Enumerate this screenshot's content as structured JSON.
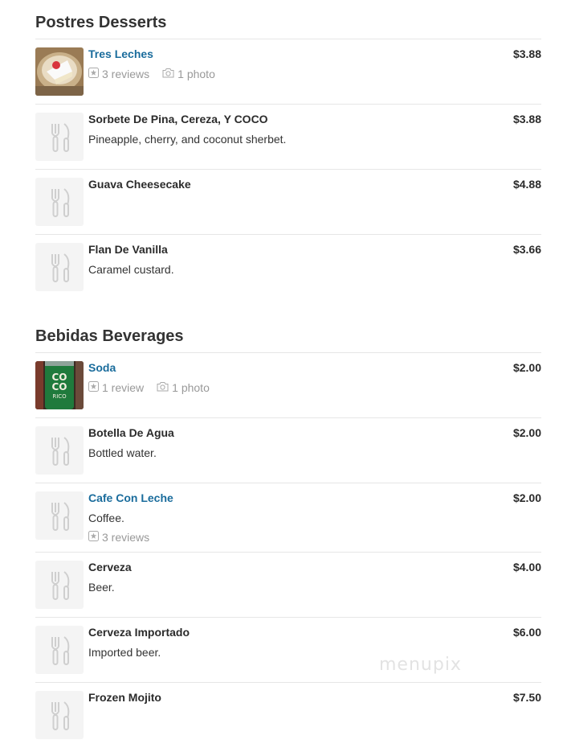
{
  "sections": [
    {
      "title": "Postres Desserts",
      "items": [
        {
          "name": "Tres Leches",
          "price": "$3.88",
          "reviews": "3 reviews",
          "photos": "1 photo"
        },
        {
          "name": "Sorbete De Pina, Cereza, Y COCO",
          "price": "$3.88",
          "desc": "Pineapple, cherry, and coconut sherbet."
        },
        {
          "name": "Guava Cheesecake",
          "price": "$4.88"
        },
        {
          "name": "Flan De Vanilla",
          "price": "$3.66",
          "desc": "Caramel custard."
        }
      ]
    },
    {
      "title": "Bebidas Beverages",
      "items": [
        {
          "name": "Soda",
          "price": "$2.00",
          "reviews": "1 review",
          "photos": "1 photo"
        },
        {
          "name": "Botella De Agua",
          "price": "$2.00",
          "desc": "Bottled water."
        },
        {
          "name": "Cafe Con Leche",
          "price": "$2.00",
          "desc": "Coffee.",
          "reviews": "3 reviews"
        },
        {
          "name": "Cerveza",
          "price": "$4.00",
          "desc": "Beer."
        },
        {
          "name": "Cerveza Importado",
          "price": "$6.00",
          "desc": "Imported beer."
        },
        {
          "name": "Frozen Mojito",
          "price": "$7.50"
        }
      ]
    }
  ],
  "watermark": "menupix",
  "colors": {
    "link": "#1a6c9c",
    "text": "#2b2b2b",
    "muted": "#999999",
    "divider": "#e6e6e6"
  },
  "icons": {
    "placeholder": "fork-knife-icon",
    "review": "star-icon",
    "photo": "camera-icon"
  }
}
